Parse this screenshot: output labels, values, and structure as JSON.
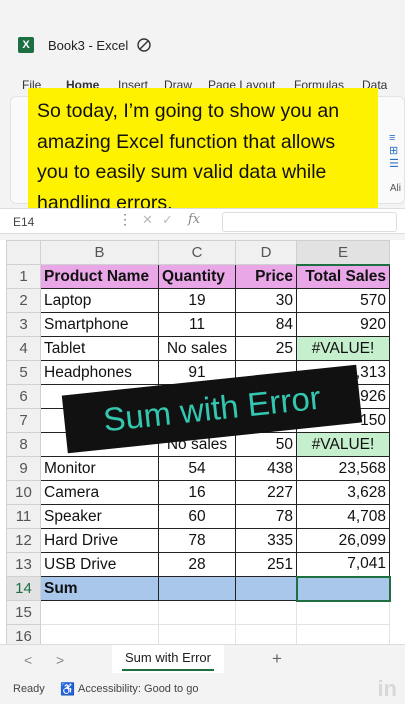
{
  "window": {
    "title": "Book3  -  Excel",
    "logo": "X"
  },
  "ribbon": {
    "tabs": [
      "File",
      "Home",
      "Insert",
      "Draw",
      "Page Layout",
      "Formulas",
      "Data"
    ],
    "right_label": "Ali"
  },
  "caption": "So today, I’m going to show you an amazing Excel function that allows you to easily sum valid data while handling errors.",
  "formula_bar": {
    "name_box": "E14",
    "separator": "⋮",
    "cancel": "✕",
    "enter": "✓",
    "fx": "fx",
    "value": ""
  },
  "grid": {
    "columns": [
      "A",
      "B",
      "C",
      "D",
      "E"
    ],
    "header": {
      "row": "1",
      "b": "Product Name",
      "c": "Quantity",
      "d": "Price",
      "e": "Total Sales"
    },
    "rows": [
      {
        "row": "2",
        "b": "Laptop",
        "c": "19",
        "d": "30",
        "e": "570"
      },
      {
        "row": "3",
        "b": "Smartphone",
        "c": "11",
        "d": "84",
        "e": "920"
      },
      {
        "row": "4",
        "b": "Tablet",
        "c": "No sales",
        "d": "25",
        "e": "#VALUE!"
      },
      {
        "row": "5",
        "b": "Headphones",
        "c": "91",
        "d": "",
        "e": ",313"
      },
      {
        "row": "6",
        "b": "",
        "c": "",
        "d": "",
        "e": "926"
      },
      {
        "row": "7",
        "b": "",
        "c": "",
        "d": "",
        "e": "150"
      },
      {
        "row": "8",
        "b": "",
        "c": "No sales",
        "d": "50",
        "e": "#VALUE!"
      },
      {
        "row": "9",
        "b": "Monitor",
        "c": "54",
        "d": "438",
        "e": "23,568"
      },
      {
        "row": "10",
        "b": "Camera",
        "c": "16",
        "d": "227",
        "e": "3,628"
      },
      {
        "row": "11",
        "b": "Speaker",
        "c": "60",
        "d": "78",
        "e": "4,708"
      },
      {
        "row": "12",
        "b": "Hard Drive",
        "c": "78",
        "d": "335",
        "e": "26,099"
      },
      {
        "row": "13",
        "b": "USB Drive",
        "c": "28",
        "d": "251",
        "e": "7,041"
      }
    ],
    "sum_row": {
      "row": "14",
      "b": "Sum"
    },
    "empty_rows": [
      "15",
      "16"
    ]
  },
  "banner": {
    "text": "Sum with Error"
  },
  "sheets": {
    "nav_prev": "<",
    "nav_next": ">",
    "active": "Sum with Error",
    "add": "+"
  },
  "status": {
    "ready": "Ready",
    "accessibility": "Accessibility: Good to go"
  },
  "colors": {
    "header_fill": "#e9a7e8",
    "error_fill": "#c6efce",
    "sum_fill": "#a9c7ea",
    "caption_bg": "#fff200",
    "banner_text": "#34c7b0",
    "excel_green": "#1d6f42"
  }
}
